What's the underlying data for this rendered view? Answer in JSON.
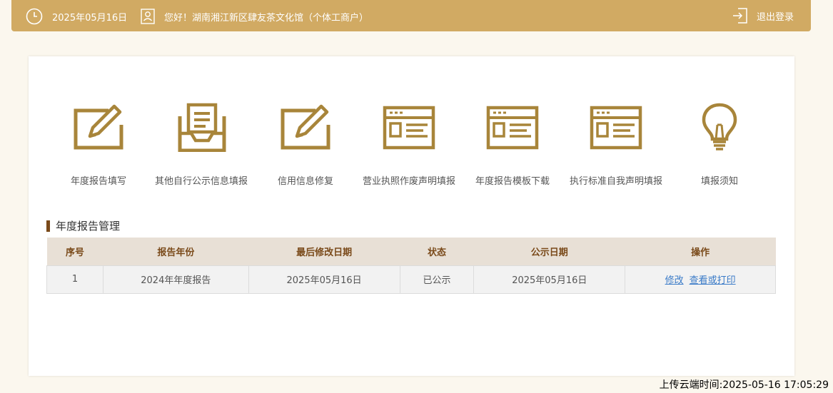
{
  "header": {
    "date": "2025年05月16日",
    "greeting": "您好！湖南湘江新区肆友茶文化馆（个体工商户）",
    "logout": "退出登录",
    "icons": [
      "clock-icon",
      "user-card-icon",
      "logout-icon"
    ]
  },
  "menu": [
    {
      "label": "年度报告填写",
      "icon": "edit-icon"
    },
    {
      "label": "其他自行公示信息填报",
      "icon": "inbox-document-icon"
    },
    {
      "label": "信用信息修复",
      "icon": "edit-icon"
    },
    {
      "label": "营业执照作废声明填报",
      "icon": "browser-window-icon"
    },
    {
      "label": "年度报告模板下载",
      "icon": "browser-window-icon"
    },
    {
      "label": "执行标准自我声明填报",
      "icon": "browser-window-icon"
    },
    {
      "label": "填报须知",
      "icon": "lightbulb-icon"
    }
  ],
  "section": {
    "title": "年度报告管理"
  },
  "table": {
    "headers": [
      "序号",
      "报告年份",
      "最后修改日期",
      "状态",
      "公示日期",
      "操作"
    ],
    "rows": [
      {
        "index": "1",
        "year": "2024年年度报告",
        "modified": "2025年05月16日",
        "status": "已公示",
        "published": "2025年05月16日",
        "actions": [
          "修改",
          "查看或打印"
        ]
      }
    ]
  },
  "footer": {
    "upload_time": "上传云端时间:2025-05-16 17:05:29"
  },
  "colors": {
    "accent": "#d1aa63",
    "icon": "#a8853a",
    "header_text": "#7a4a1a",
    "link": "#3a7bc8"
  }
}
